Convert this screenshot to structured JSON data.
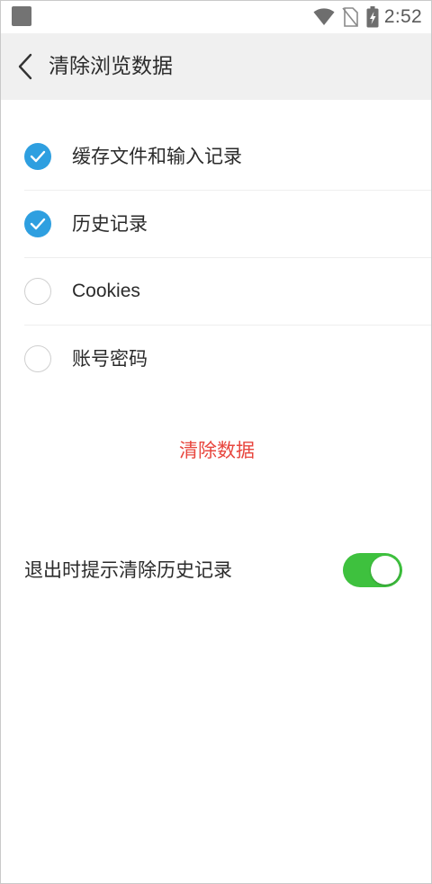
{
  "status_bar": {
    "time": "2:52",
    "icons": [
      "app-notification-icon",
      "wifi-icon",
      "no-sim-icon",
      "battery-charging-icon"
    ]
  },
  "header": {
    "back_icon": "chevron-left-icon",
    "title": "清除浏览数据"
  },
  "options": [
    {
      "label": "缓存文件和输入记录",
      "checked": true
    },
    {
      "label": "历史记录",
      "checked": true
    },
    {
      "label": "Cookies",
      "checked": false
    },
    {
      "label": "账号密码",
      "checked": false
    }
  ],
  "clear_button": {
    "label": "清除数据",
    "color": "#e8463e"
  },
  "exit_prompt": {
    "label": "退出时提示清除历史记录",
    "enabled": true,
    "switch_color": "#3ec13e"
  },
  "colors": {
    "check_accent": "#2e9fe0",
    "header_background": "#f0f0f0"
  }
}
